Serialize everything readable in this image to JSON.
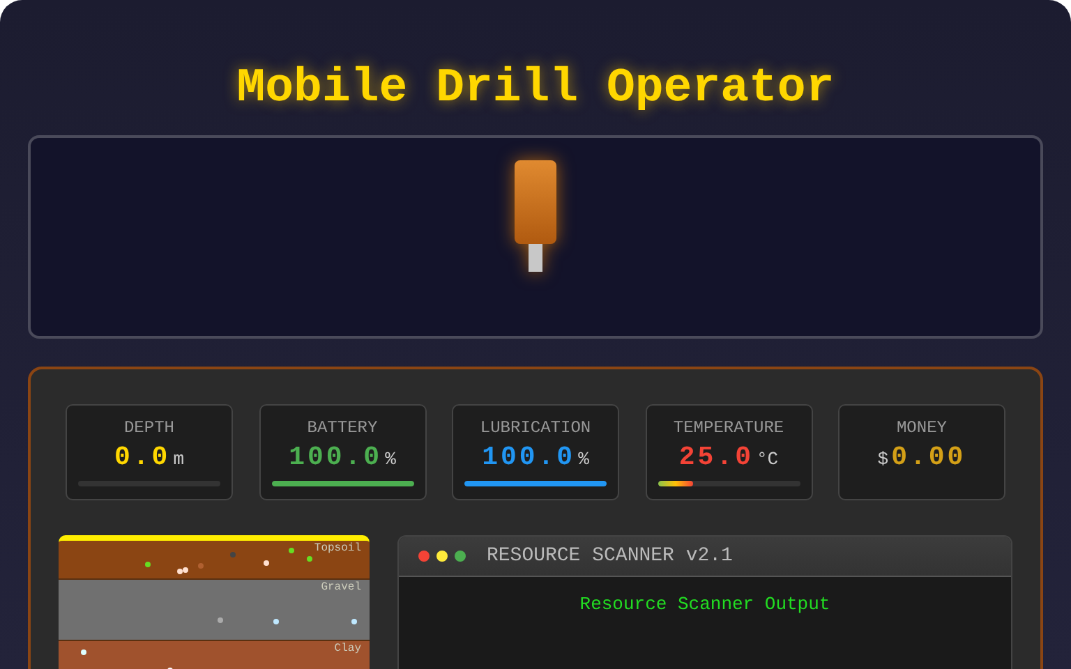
{
  "title": "Mobile Drill Operator",
  "gauges": [
    {
      "label": "DEPTH",
      "value": "0.0",
      "unit": "m",
      "color": "#ffd700",
      "kind": "plain",
      "level": 0
    },
    {
      "label": "BATTERY",
      "value": "100.0",
      "unit": "%",
      "color": "#4caf50",
      "kind": "plain",
      "level": 1
    },
    {
      "label": "LUBRICATION",
      "value": "100.0",
      "unit": "%",
      "color": "#2196f3",
      "kind": "plain",
      "level": 1
    },
    {
      "label": "TEMPERATURE",
      "value": "25.0",
      "unit": "°C",
      "color": "#f44336",
      "kind": "gradient",
      "level": 0.25
    },
    {
      "label": "MONEY",
      "prefix": "$",
      "value": "0.00",
      "color": "#d4a017",
      "kind": "none"
    }
  ],
  "strata": [
    {
      "label": "Topsoil",
      "color": "#8b4513"
    },
    {
      "label": "Gravel",
      "color": "#707070"
    },
    {
      "label": "Clay",
      "color": "#a0522d"
    }
  ],
  "scanner": {
    "title": "RESOURCE SCANNER v2.1",
    "output": "Resource Scanner Output"
  }
}
